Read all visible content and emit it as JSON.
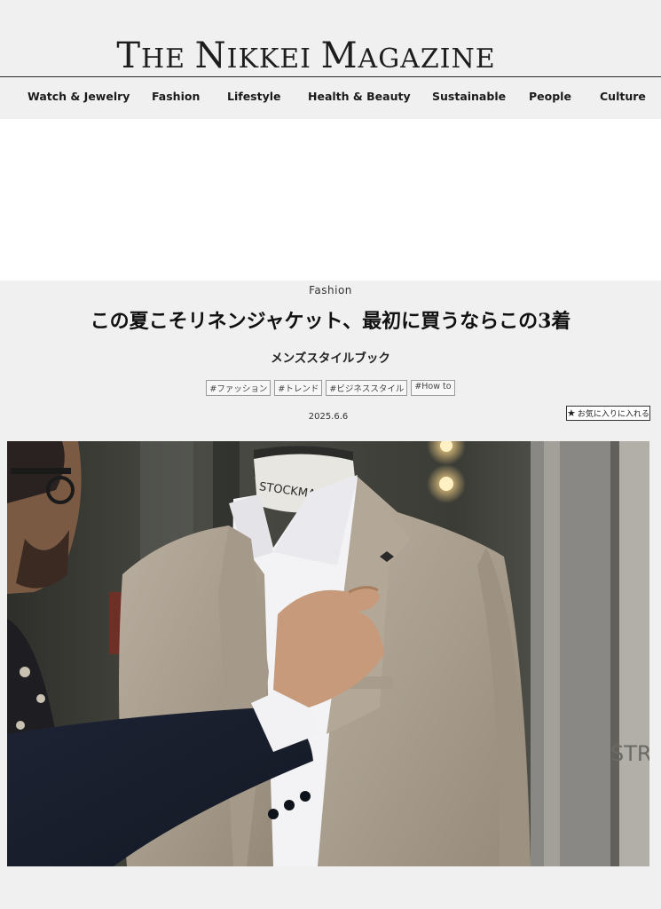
{
  "site": {
    "logo": {
      "parts": [
        "T",
        "HE ",
        "N",
        "IKKEI ",
        "M",
        "AGAZINE"
      ]
    }
  },
  "nav": {
    "items": [
      "Watch & Jewelry",
      "Fashion",
      "Lifestyle",
      "Health & Beauty",
      "Sustainable",
      "People",
      "Culture"
    ]
  },
  "article": {
    "category": "Fashion",
    "title": "この夏こそリネンジャケット、最初に買うならこの3着",
    "subtitle": "メンズスタイルブック",
    "tags": [
      "#ファッション",
      "#トレンド",
      "#ビジネススタイル",
      "#How to"
    ],
    "date": "2025.6.6",
    "favorite_label": "お気に入りに入れる",
    "hero_image": {
      "mannequin_label": "STOCKMAN",
      "sign_text": "STRA"
    }
  },
  "colors": {
    "background": "#f0f0f0",
    "text": "#1a1a1a",
    "ad_area": "#ffffff"
  },
  "icons": {
    "favorite": "star-icon"
  }
}
